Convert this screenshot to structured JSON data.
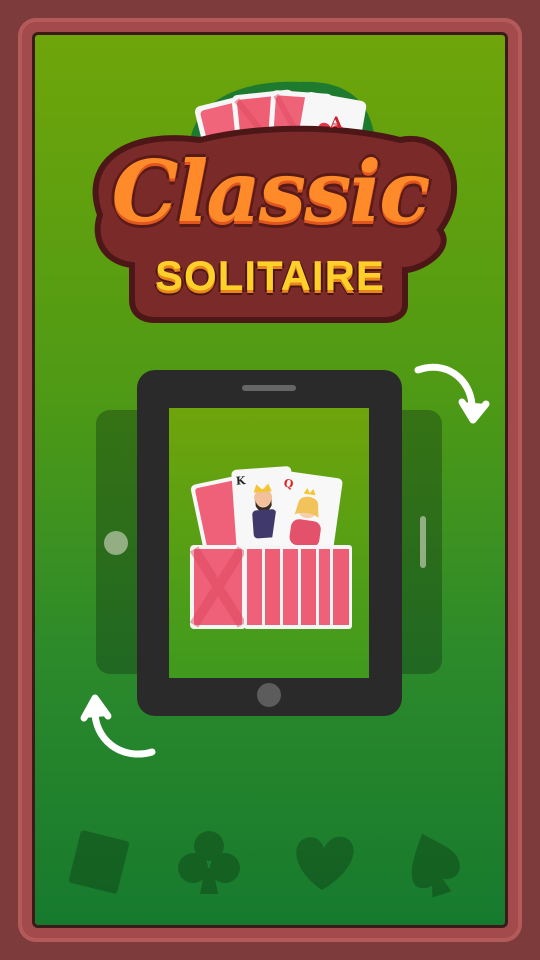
{
  "title": {
    "line1": "Classic",
    "line2": "SOLITAIRE"
  },
  "cards": {
    "king_rank": "K",
    "queen_rank": "Q",
    "ace_rank": "A"
  },
  "icons": {
    "rotate_clockwise": "rotate-clockwise-arrow-icon",
    "rotate_counterclockwise": "rotate-counterclockwise-arrow-icon",
    "suits": [
      "diamond-icon",
      "club-icon",
      "heart-icon",
      "spade-icon"
    ]
  },
  "colors": {
    "frame": "#7e3b3c",
    "felt_top": "#6fa50a",
    "felt_bottom": "#167a2e",
    "card_back": "#f0657a",
    "tablet": "#2a2a2a",
    "title_orange": "#ff8a2a",
    "title_yellow": "#ffd02a"
  }
}
